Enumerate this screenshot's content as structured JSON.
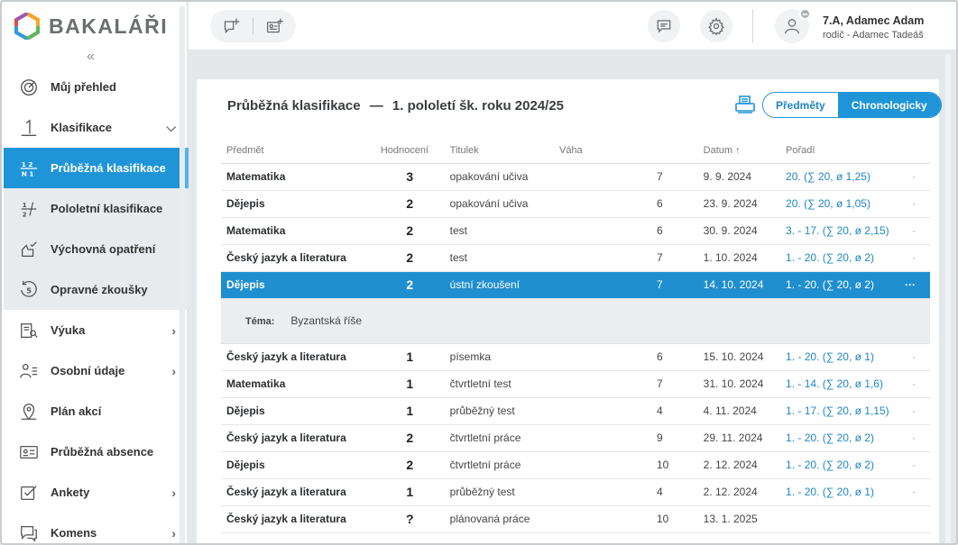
{
  "app": {
    "logo_text": "BAKALÁŘI",
    "accent": "#1f95d8"
  },
  "sidebar": {
    "items": [
      {
        "label": "Můj přehled",
        "icon": "target-icon"
      },
      {
        "label": "Klasifikace",
        "icon": "number-one-icon"
      },
      {
        "label": "Průběžná klasifikace",
        "icon": "fraction-grid-icon"
      },
      {
        "label": "Pololetní klasifikace",
        "icon": "half-fraction-icon"
      },
      {
        "label": "Výchovná opatření",
        "icon": "hand-check-icon"
      },
      {
        "label": "Opravné zkoušky",
        "icon": "circled-five-icon"
      },
      {
        "label": "Výuka",
        "icon": "book-icon"
      },
      {
        "label": "Osobní údaje",
        "icon": "people-icon"
      },
      {
        "label": "Plán akcí",
        "icon": "map-pin-icon"
      },
      {
        "label": "Průběžná absence",
        "icon": "id-card-icon"
      },
      {
        "label": "Ankety",
        "icon": "checkbox-icon"
      },
      {
        "label": "Komens",
        "icon": "chat-icon"
      }
    ]
  },
  "header": {
    "user_name": "7.A, Adamec Adam",
    "user_sub": "rodič - Adamec Tadeáš"
  },
  "main": {
    "title": "Průběžná klasifikace",
    "title_sep": "—",
    "period": "1. pololetí šk. roku 2024/25",
    "toggle": {
      "left": "Předměty",
      "right": "Chronologicky"
    },
    "columns": {
      "subject": "Předmět",
      "grade": "Hodnocení",
      "title": "Titulek",
      "weight": "Váha",
      "date": "Datum",
      "sort_arrow": "↑",
      "rank": "Pořadí"
    },
    "rows": [
      {
        "subject": "Matematika",
        "grade": "3",
        "title": "opakování učiva",
        "weight": "7",
        "date": "9. 9. 2024",
        "rank": "20. (∑ 20, ø 1,25)",
        "more": "·"
      },
      {
        "subject": "Dějepis",
        "grade": "2",
        "title": "opakování učiva",
        "weight": "6",
        "date": "23. 9. 2024",
        "rank": "20. (∑ 20, ø 1,05)",
        "more": "·"
      },
      {
        "subject": "Matematika",
        "grade": "2",
        "title": "test",
        "weight": "6",
        "date": "30. 9. 2024",
        "rank": "3. - 17. (∑ 20, ø 2,15)",
        "more": "·"
      },
      {
        "subject": "Český jazyk a literatura",
        "grade": "2",
        "title": "test",
        "weight": "7",
        "date": "1. 10. 2024",
        "rank": "1. - 20. (∑ 20, ø 2)",
        "more": "·"
      },
      {
        "subject": "Dějepis",
        "grade": "2",
        "title": "ústní zkoušení",
        "weight": "7",
        "date": "14. 10. 2024",
        "rank": "1. - 20. (∑ 20, ø 2)",
        "more": "···"
      },
      {
        "subject": "Český jazyk a literatura",
        "grade": "1",
        "title": "písemka",
        "weight": "6",
        "date": "15. 10. 2024",
        "rank": "1. - 20. (∑ 20, ø 1)",
        "more": "·"
      },
      {
        "subject": "Matematika",
        "grade": "1",
        "title": "čtvrtletní test",
        "weight": "7",
        "date": "31. 10. 2024",
        "rank": "1. - 14. (∑ 20, ø 1,6)",
        "more": "·"
      },
      {
        "subject": "Dějepis",
        "grade": "1",
        "title": "průběžný test",
        "weight": "4",
        "date": "4. 11. 2024",
        "rank": "1. - 17. (∑ 20, ø 1,15)",
        "more": "·"
      },
      {
        "subject": "Český jazyk a literatura",
        "grade": "2",
        "title": "čtvrtletní práce",
        "weight": "9",
        "date": "29. 11. 2024",
        "rank": "1. - 20. (∑ 20, ø 2)",
        "more": "·"
      },
      {
        "subject": "Dějepis",
        "grade": "2",
        "title": "čtvrtletní práce",
        "weight": "10",
        "date": "2. 12. 2024",
        "rank": "1. - 20. (∑ 20, ø 2)",
        "more": "·"
      },
      {
        "subject": "Český jazyk a literatura",
        "grade": "1",
        "title": "průběžný test",
        "weight": "4",
        "date": "2. 12. 2024",
        "rank": "1. - 20. (∑ 20, ø 1)",
        "more": "·"
      },
      {
        "subject": "Český jazyk a literatura",
        "grade": "?",
        "title": "plánovaná práce",
        "weight": "10",
        "date": "13. 1. 2025",
        "rank": "",
        "more": ""
      }
    ],
    "detail": {
      "label": "Téma:",
      "value": "Byzantská říše"
    }
  }
}
